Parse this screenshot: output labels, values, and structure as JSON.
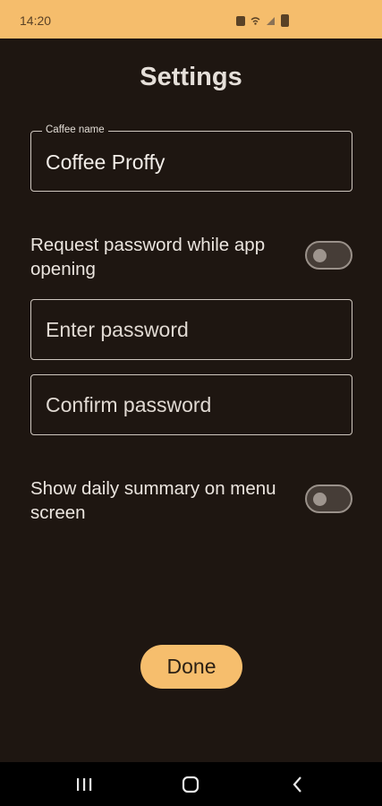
{
  "status_bar": {
    "time": "14:20",
    "icons": [
      "notification-icon",
      "wifi-icon",
      "signal-icon",
      "battery-icon"
    ],
    "background_color": "#f5bd6c"
  },
  "header": {
    "title": "Settings"
  },
  "cafe_name": {
    "label": "Caffee name",
    "value": "Coffee Proffy"
  },
  "password_option": {
    "text": "Request password while app opening",
    "enabled": false
  },
  "password_fields": {
    "enter_placeholder": "Enter password",
    "confirm_placeholder": "Confirm password"
  },
  "summary_option": {
    "text": "Show daily summary on menu screen",
    "enabled": false
  },
  "actions": {
    "done_label": "Done",
    "accent_color": "#f6be6d"
  },
  "nav_bar": {
    "buttons": [
      "recents-icon",
      "home-icon",
      "back-icon"
    ]
  }
}
